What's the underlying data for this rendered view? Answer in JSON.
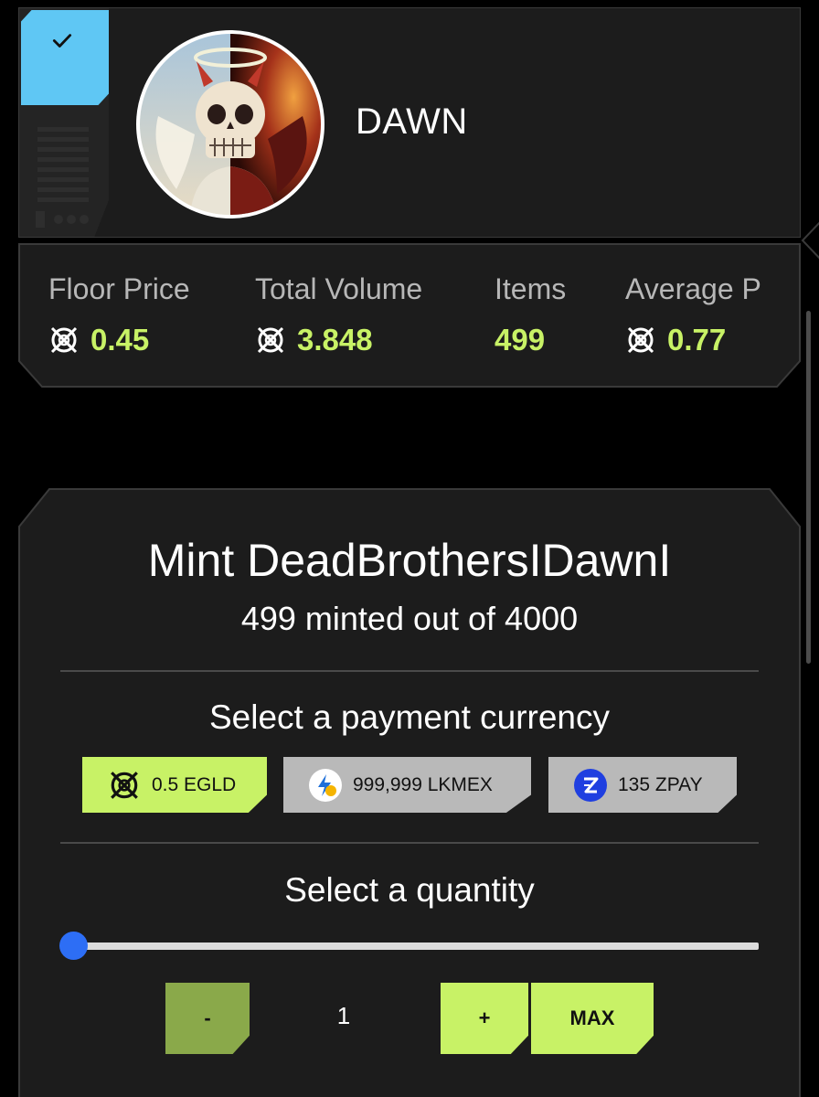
{
  "collection": {
    "name": "DAWN",
    "verified_icon": "check-icon",
    "avatar_icon": "skull-avatar"
  },
  "stats": [
    {
      "label": "Floor Price",
      "value": "0.45",
      "icon": "egld-icon"
    },
    {
      "label": "Total Volume",
      "value": "3.848",
      "icon": "egld-icon"
    },
    {
      "label": "Items",
      "value": "499"
    },
    {
      "label": "Average P",
      "value": "0.77",
      "icon": "egld-icon"
    }
  ],
  "mint": {
    "title": "Mint DeadBrothersIDawnI",
    "subtitle": "499 minted out of 4000",
    "currency_title": "Select a payment currency",
    "currencies": [
      {
        "label": "0.5 EGLD",
        "icon": "egld-icon",
        "selected": true
      },
      {
        "label": "999,999 LKMEX",
        "icon": "lightning-icon",
        "selected": false
      },
      {
        "label": "135 ZPAY",
        "icon": "zpay-icon",
        "selected": false
      }
    ],
    "quantity_title": "Select a quantity",
    "quantity": "1",
    "slider_fraction": 0,
    "minus_label": "-",
    "plus_label": "+",
    "max_label": "MAX"
  },
  "colors": {
    "accent": "#c8f266",
    "verified": "#5fc7f4",
    "card": "#1c1c1c",
    "slider_thumb": "#2d6ef5"
  }
}
